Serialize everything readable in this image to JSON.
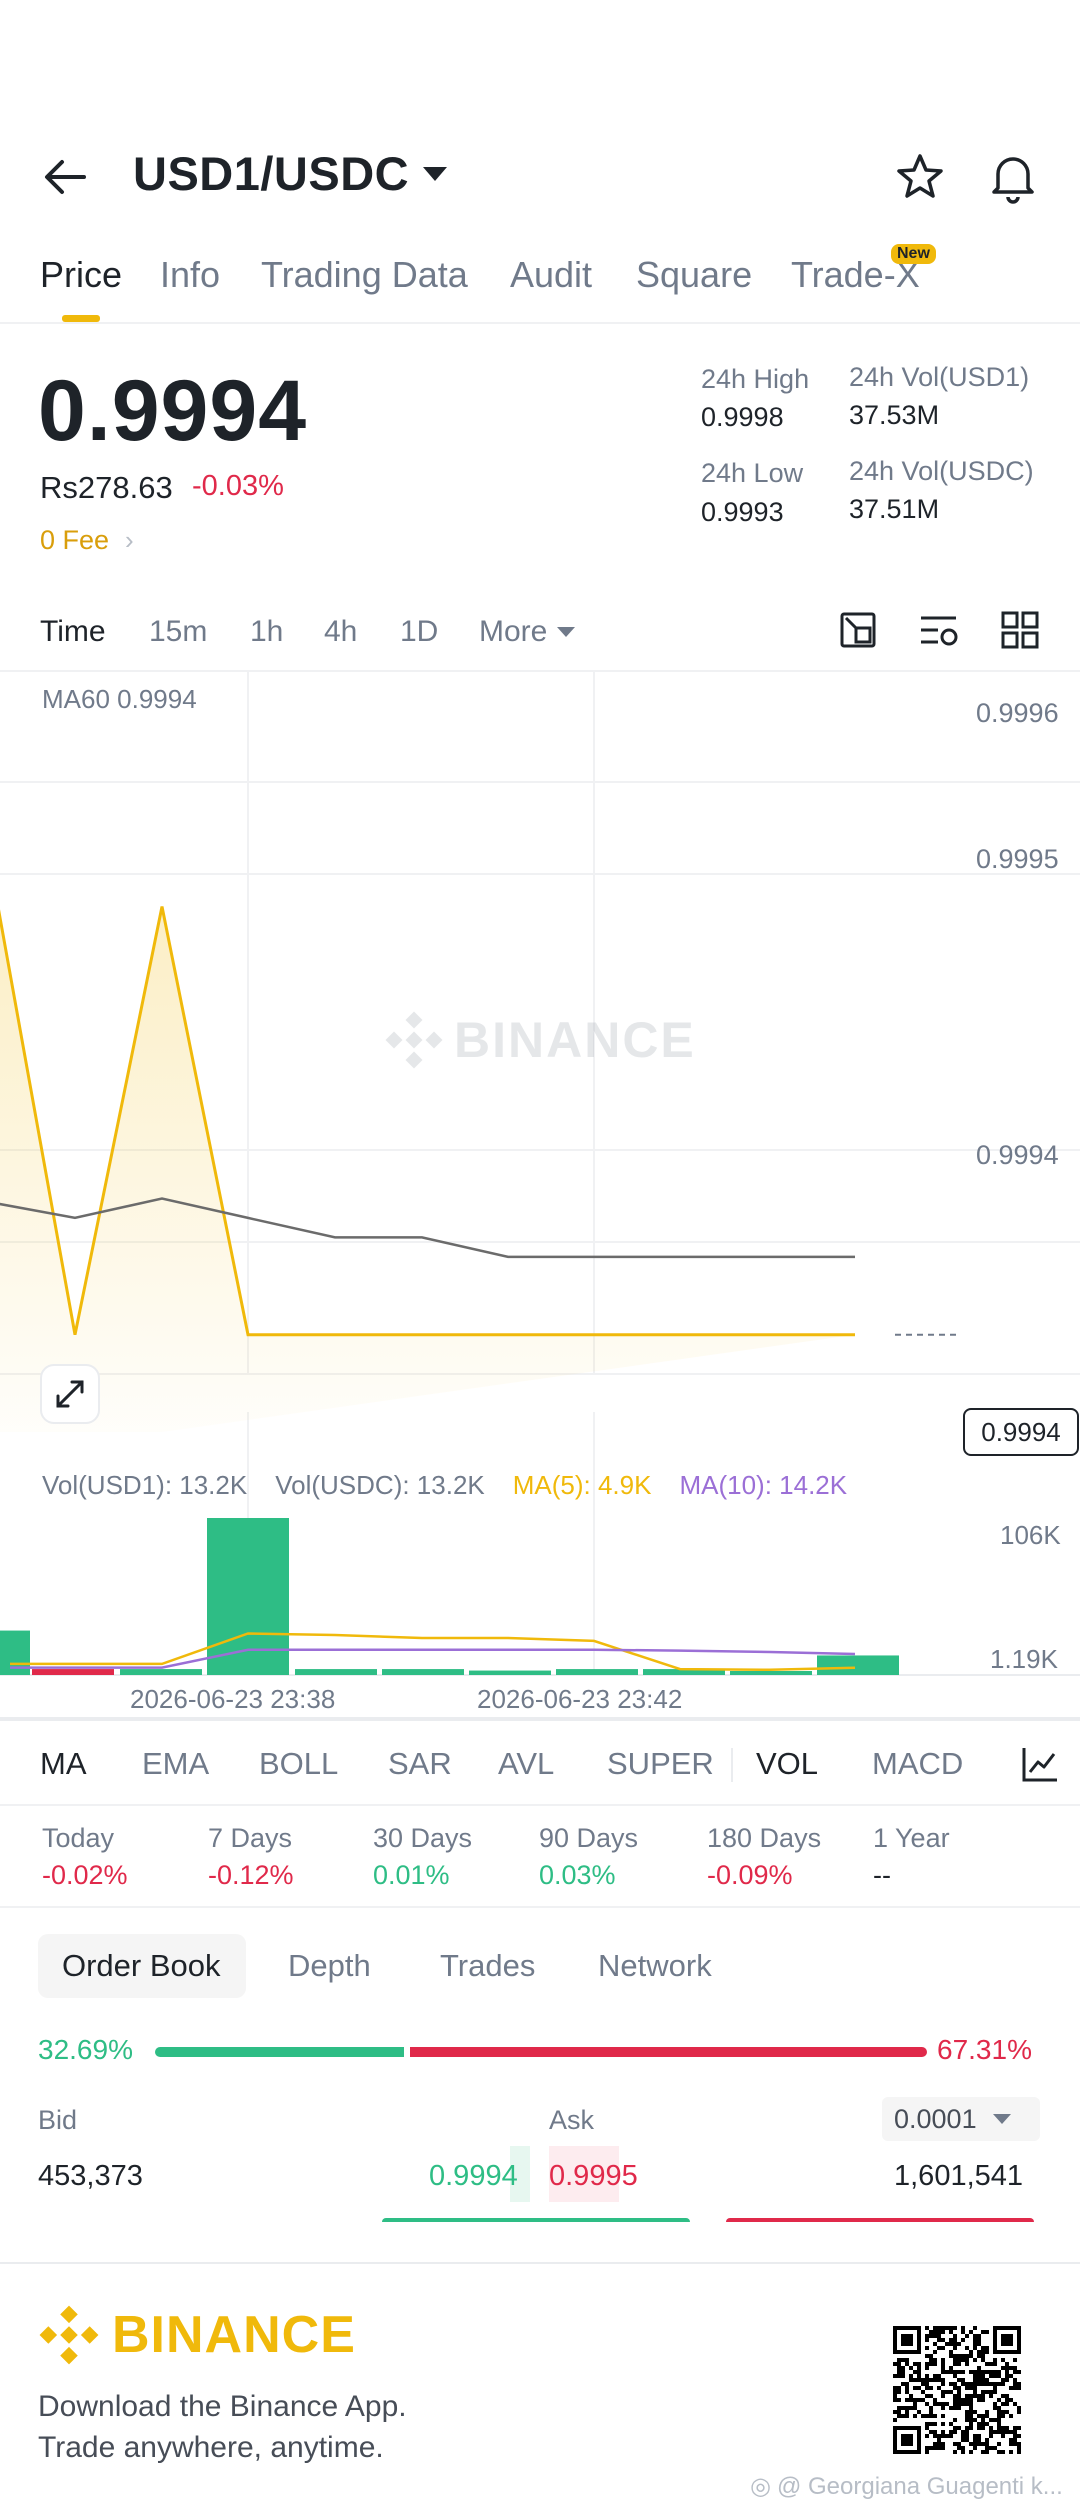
{
  "header": {
    "pair": "USD1/USDC"
  },
  "tabs": [
    {
      "label": "Price"
    },
    {
      "label": "Info"
    },
    {
      "label": "Trading Data"
    },
    {
      "label": "Audit"
    },
    {
      "label": "Square"
    },
    {
      "label": "Trade-X",
      "badge": "New"
    }
  ],
  "price": {
    "last": "0.9994",
    "fiat": "Rs278.63",
    "change": "-0.03%",
    "fee": "0 Fee"
  },
  "stats": {
    "high_label": "24h High",
    "high": "0.9998",
    "low_label": "24h Low",
    "low": "0.9993",
    "vol1_label": "24h Vol(USD1)",
    "vol1": "37.53M",
    "vol2_label": "24h Vol(USDC)",
    "vol2": "37.51M"
  },
  "timeframes": [
    "Time",
    "15m",
    "1h",
    "4h",
    "1D",
    "More"
  ],
  "chart": {
    "ma60_label": "MA60 0.9994",
    "watermark": "BINANCE",
    "price_ticks": [
      "0.9996",
      "0.9995",
      "0.9994"
    ],
    "last_price_tag": "0.9994",
    "vol_legend": {
      "vol1": "Vol(USD1): 13.2K",
      "vol2": "Vol(USDC): 13.2K",
      "ma5": "MA(5): 4.9K",
      "ma10": "MA(10): 14.2K"
    },
    "vol_ticks": [
      "106K",
      "1.19K"
    ],
    "time_labels": [
      "2026-06-23 23:38",
      "2026-06-23 23:42"
    ],
    "colors": {
      "price_line": "#f0b90b",
      "ma60": "#6b6b6b",
      "ma5": "#f0b90b",
      "ma10": "#9b6fd6",
      "vol_up": "#2ebd85",
      "vol_down": "#e0294a"
    }
  },
  "chart_data": {
    "type": "line",
    "title": "",
    "series": [
      {
        "values": [
          0.9996,
          0.9993,
          0.99952,
          0.9993,
          0.9993,
          0.9993,
          0.9993,
          0.9993,
          0.9993,
          0.9993
        ]
      },
      {
        "name": "MA60",
        "values": [
          0.99937,
          0.99936,
          0.99937,
          0.99936,
          0.99935,
          0.99935,
          0.99934,
          0.99934,
          0.99934,
          0.99934
        ]
      }
    ],
    "volume": {
      "values": [
        30000,
        4000,
        4000,
        106000,
        4000,
        4000,
        3000,
        4000,
        4000,
        1190,
        13200
      ],
      "directions": [
        "up",
        "down",
        "up",
        "up",
        "up",
        "up",
        "up",
        "up",
        "up",
        "up",
        "up"
      ],
      "ma5": [
        7500,
        7500,
        7500,
        28000,
        27000,
        25000,
        25000,
        23000,
        4000,
        3500,
        4900
      ],
      "ma10": [
        5000,
        5000,
        5000,
        17000,
        17000,
        17000,
        17000,
        17000,
        16500,
        15500,
        14200
      ]
    },
    "ylim": [
      0.99925,
      0.99962
    ],
    "ylabel": "",
    "xlabel": ""
  },
  "indicators": [
    "MA",
    "EMA",
    "BOLL",
    "SAR",
    "AVL",
    "SUPER",
    "VOL",
    "MACD"
  ],
  "performance": [
    {
      "label": "Today",
      "value": "-0.02%",
      "dir": "down"
    },
    {
      "label": "7 Days",
      "value": "-0.12%",
      "dir": "down"
    },
    {
      "label": "30 Days",
      "value": "0.01%",
      "dir": "up"
    },
    {
      "label": "90 Days",
      "value": "0.03%",
      "dir": "up"
    },
    {
      "label": "180 Days",
      "value": "-0.09%",
      "dir": "down"
    },
    {
      "label": "1 Year",
      "value": "--",
      "dir": "flat"
    }
  ],
  "orderbook": {
    "tabs": [
      "Order Book",
      "Depth",
      "Trades",
      "Network"
    ],
    "bid_pct": "32.69%",
    "ask_pct": "67.31%",
    "bid_ratio": 0.3269,
    "bid_label": "Bid",
    "ask_label": "Ask",
    "precision": "0.0001",
    "bid_qty": "453,373",
    "bid_price": "0.9994",
    "ask_price": "0.9995",
    "ask_qty": "1,601,541"
  },
  "footer": {
    "brand": "BINANCE",
    "line1": "Download the Binance App.",
    "line2": "Trade anywhere, anytime.",
    "credit": "@ Georgiana Guagenti k..."
  }
}
